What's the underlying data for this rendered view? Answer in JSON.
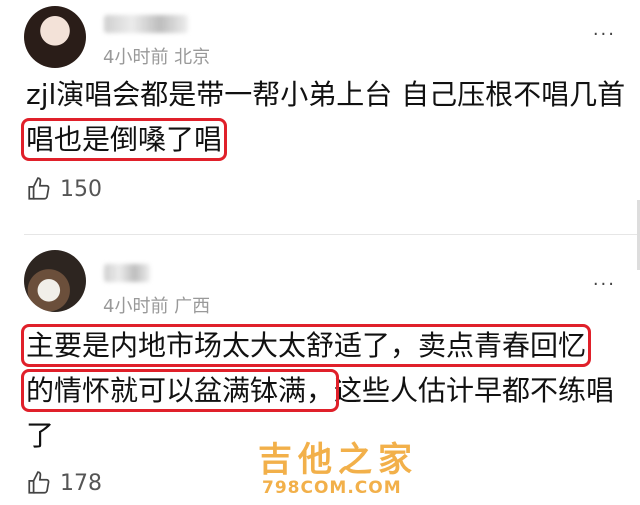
{
  "comments": [
    {
      "meta": "4小时前 北京",
      "text_plain": "zjl演唱会都是带一帮小弟上台 自己压根不唱几首",
      "text_highlight": "唱也是倒嗓了唱",
      "likes": "150"
    },
    {
      "meta": "4小时前 广西",
      "text_hl1": "主要是内地市场太大太舒适了，卖点青春回忆",
      "text_hl2": "的情怀就可以盆满钵满，",
      "text_tail": "这些人估计早都不练唱了",
      "likes": "178"
    }
  ],
  "more_label": "···",
  "watermark": {
    "title": "吉他之家",
    "url": "798COM.COM"
  },
  "colors": {
    "highlight": "#e0202a",
    "meta": "#999999",
    "watermark": "#f2b04a"
  },
  "icons": {
    "like": "thumbs-up-icon",
    "more": "more-horizontal-icon"
  }
}
